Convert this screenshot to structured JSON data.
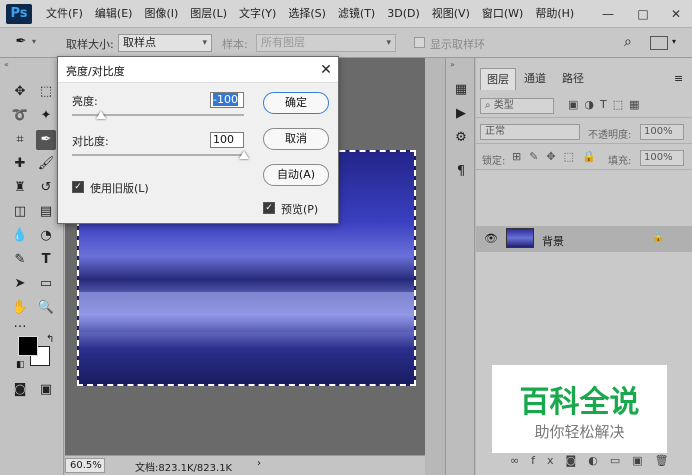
{
  "app": {
    "logo": "Ps"
  },
  "menu": [
    "文件(F)",
    "编辑(E)",
    "图像(I)",
    "图层(L)",
    "文字(Y)",
    "选择(S)",
    "滤镜(T)",
    "3D(D)",
    "视图(V)",
    "窗口(W)",
    "帮助(H)"
  ],
  "window_controls": {
    "minimize": "—",
    "maximize": "□",
    "close": "✕"
  },
  "options": {
    "sample_size_label": "取样大小:",
    "sample_size_value": "取样点",
    "sample_label": "样本:",
    "sample_value": "所有图层",
    "show_ring_label": "显示取样环"
  },
  "status": {
    "zoom": "60.5%",
    "doc_info": "文档:823.1K/823.1K"
  },
  "layers_panel": {
    "tabs": [
      "图层",
      "通道",
      "路径"
    ],
    "filter_label": "类型",
    "blend_mode": "正常",
    "opacity_label": "不透明度:",
    "opacity_value": "100%",
    "lock_label": "锁定:",
    "fill_label": "填充:",
    "fill_value": "100%",
    "layer_name": "背景"
  },
  "dialog": {
    "title": "亮度/对比度",
    "brightness_label": "亮度:",
    "brightness_value": "-100",
    "brightness_level": -100,
    "contrast_label": "对比度:",
    "contrast_value": "100",
    "contrast_level": 100,
    "legacy_label": "使用旧版(L)",
    "legacy_checked": true,
    "ok_label": "确定",
    "cancel_label": "取消",
    "auto_label": "自动(A)",
    "preview_label": "预览(P)",
    "preview_checked": true
  },
  "watermark": {
    "title": "百科全说",
    "subtitle": "助你轻松解决"
  },
  "colors": {
    "accent": "#3478d4",
    "watermark_green": "#1aa84c"
  }
}
